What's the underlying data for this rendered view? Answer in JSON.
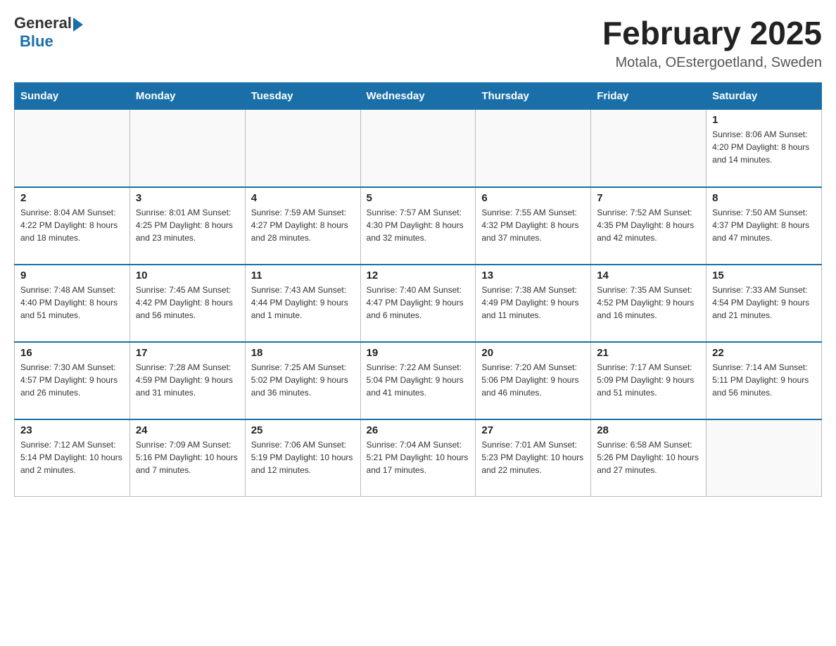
{
  "logo": {
    "general": "General",
    "blue": "Blue"
  },
  "title": "February 2025",
  "subtitle": "Motala, OEstergoetland, Sweden",
  "days_header": [
    "Sunday",
    "Monday",
    "Tuesday",
    "Wednesday",
    "Thursday",
    "Friday",
    "Saturday"
  ],
  "weeks": [
    [
      {
        "num": "",
        "info": ""
      },
      {
        "num": "",
        "info": ""
      },
      {
        "num": "",
        "info": ""
      },
      {
        "num": "",
        "info": ""
      },
      {
        "num": "",
        "info": ""
      },
      {
        "num": "",
        "info": ""
      },
      {
        "num": "1",
        "info": "Sunrise: 8:06 AM\nSunset: 4:20 PM\nDaylight: 8 hours and 14 minutes."
      }
    ],
    [
      {
        "num": "2",
        "info": "Sunrise: 8:04 AM\nSunset: 4:22 PM\nDaylight: 8 hours and 18 minutes."
      },
      {
        "num": "3",
        "info": "Sunrise: 8:01 AM\nSunset: 4:25 PM\nDaylight: 8 hours and 23 minutes."
      },
      {
        "num": "4",
        "info": "Sunrise: 7:59 AM\nSunset: 4:27 PM\nDaylight: 8 hours and 28 minutes."
      },
      {
        "num": "5",
        "info": "Sunrise: 7:57 AM\nSunset: 4:30 PM\nDaylight: 8 hours and 32 minutes."
      },
      {
        "num": "6",
        "info": "Sunrise: 7:55 AM\nSunset: 4:32 PM\nDaylight: 8 hours and 37 minutes."
      },
      {
        "num": "7",
        "info": "Sunrise: 7:52 AM\nSunset: 4:35 PM\nDaylight: 8 hours and 42 minutes."
      },
      {
        "num": "8",
        "info": "Sunrise: 7:50 AM\nSunset: 4:37 PM\nDaylight: 8 hours and 47 minutes."
      }
    ],
    [
      {
        "num": "9",
        "info": "Sunrise: 7:48 AM\nSunset: 4:40 PM\nDaylight: 8 hours and 51 minutes."
      },
      {
        "num": "10",
        "info": "Sunrise: 7:45 AM\nSunset: 4:42 PM\nDaylight: 8 hours and 56 minutes."
      },
      {
        "num": "11",
        "info": "Sunrise: 7:43 AM\nSunset: 4:44 PM\nDaylight: 9 hours and 1 minute."
      },
      {
        "num": "12",
        "info": "Sunrise: 7:40 AM\nSunset: 4:47 PM\nDaylight: 9 hours and 6 minutes."
      },
      {
        "num": "13",
        "info": "Sunrise: 7:38 AM\nSunset: 4:49 PM\nDaylight: 9 hours and 11 minutes."
      },
      {
        "num": "14",
        "info": "Sunrise: 7:35 AM\nSunset: 4:52 PM\nDaylight: 9 hours and 16 minutes."
      },
      {
        "num": "15",
        "info": "Sunrise: 7:33 AM\nSunset: 4:54 PM\nDaylight: 9 hours and 21 minutes."
      }
    ],
    [
      {
        "num": "16",
        "info": "Sunrise: 7:30 AM\nSunset: 4:57 PM\nDaylight: 9 hours and 26 minutes."
      },
      {
        "num": "17",
        "info": "Sunrise: 7:28 AM\nSunset: 4:59 PM\nDaylight: 9 hours and 31 minutes."
      },
      {
        "num": "18",
        "info": "Sunrise: 7:25 AM\nSunset: 5:02 PM\nDaylight: 9 hours and 36 minutes."
      },
      {
        "num": "19",
        "info": "Sunrise: 7:22 AM\nSunset: 5:04 PM\nDaylight: 9 hours and 41 minutes."
      },
      {
        "num": "20",
        "info": "Sunrise: 7:20 AM\nSunset: 5:06 PM\nDaylight: 9 hours and 46 minutes."
      },
      {
        "num": "21",
        "info": "Sunrise: 7:17 AM\nSunset: 5:09 PM\nDaylight: 9 hours and 51 minutes."
      },
      {
        "num": "22",
        "info": "Sunrise: 7:14 AM\nSunset: 5:11 PM\nDaylight: 9 hours and 56 minutes."
      }
    ],
    [
      {
        "num": "23",
        "info": "Sunrise: 7:12 AM\nSunset: 5:14 PM\nDaylight: 10 hours and 2 minutes."
      },
      {
        "num": "24",
        "info": "Sunrise: 7:09 AM\nSunset: 5:16 PM\nDaylight: 10 hours and 7 minutes."
      },
      {
        "num": "25",
        "info": "Sunrise: 7:06 AM\nSunset: 5:19 PM\nDaylight: 10 hours and 12 minutes."
      },
      {
        "num": "26",
        "info": "Sunrise: 7:04 AM\nSunset: 5:21 PM\nDaylight: 10 hours and 17 minutes."
      },
      {
        "num": "27",
        "info": "Sunrise: 7:01 AM\nSunset: 5:23 PM\nDaylight: 10 hours and 22 minutes."
      },
      {
        "num": "28",
        "info": "Sunrise: 6:58 AM\nSunset: 5:26 PM\nDaylight: 10 hours and 27 minutes."
      },
      {
        "num": "",
        "info": ""
      }
    ]
  ]
}
